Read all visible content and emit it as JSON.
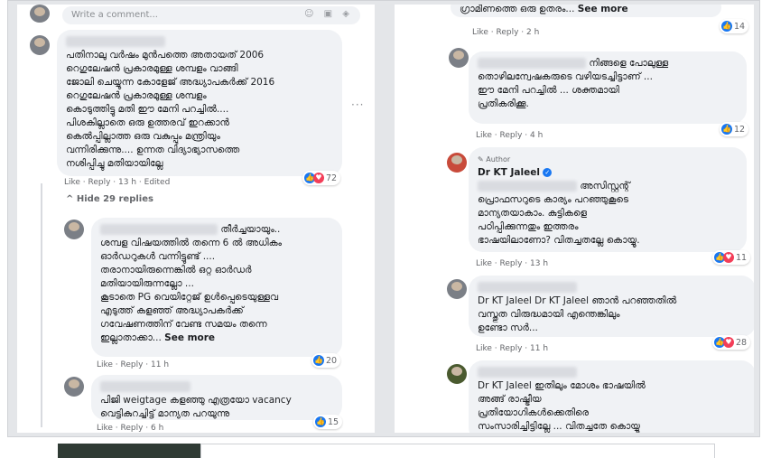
{
  "left": {
    "write_placeholder": "Write a comment...",
    "comment1": {
      "lines": [
        "പതിനാലു വർഷം മുൻപത്തെ അതായത് 2006",
        "റെഗുലേഷൻ പ്രകാരമുള്ള ശമ്പളം വാങ്ങി",
        "ജോലി ചെയ്യുന്ന കോളേജ് അദ്ധ്യാപകർക്ക് 2016",
        "റെഗുലേഷൻ പ്രകാരമുള്ള ശമ്പളം",
        "കൊടുത്തിട്ടു മതി ഈ മേനി പറച്ചിൽ....",
        "പിശകില്ലാതെ ഒരു ഉത്തരവ് ഇറക്കാൻ",
        "കെൽപ്പില്ലാത്ത ഒരു വകുപ്പും മന്ത്രിയും",
        "വന്നിരിക്കുന്നു.... ഉന്നത വിദ്യാഭ്യാസത്തെ",
        "നശിപ്പിച്ചു മതിയായില്ലേ"
      ],
      "meta": "Like · Reply · 13 h · Edited",
      "reactions": "72",
      "hide_replies": "^ Hide 29 replies"
    },
    "reply1": {
      "lines": [
        "തീർച്ചയായും..",
        "ശമ്പള വിഷയത്തിൽ തന്നെ 6 ൽ അധികം",
        "ഓർഡറുകൾ വന്നിട്ടുണ്ട് ....",
        "തരാനായിരുന്നെങ്കിൽ ഒറ്റ ഓർഡർ",
        "മതിയായിരുന്നല്ലോ ...",
        "കൂടാതെ PG വെയിറ്റേജ് ഉൾപ്പെടെയുള്ളവ",
        "എടുത്ത് കളഞ്ഞ് അദ്ധ്യാപകർക്ക്",
        "ഗവേഷണത്തിന് വേണ്ട സമയം തന്നെ",
        "ഇല്ലാതാക്കാ..."
      ],
      "see_more": "See more",
      "meta": "Like · Reply · 11 h",
      "reactions": "20"
    },
    "reply2": {
      "lines": [
        "പിജി weigtage കളഞ്ഞു എത്രയോ vacancy",
        "വെട്ടികുറച്ചിട്ട് മാന്യത പറയുന്നു"
      ],
      "meta": "Like · Reply · 6 h",
      "reactions": "15"
    }
  },
  "right": {
    "top_fragment": "ഗ്രാമീണത്തെ ഒരു ഉതരം...",
    "top_see_more": "See more",
    "top_meta": "Like · Reply · 2 h",
    "top_reactions": "14",
    "comment2": {
      "lines": [
        "നിങ്ങളെ പോലുള്ള",
        "തൊഴിലന്വേഷകരുടെ വഴിയടച്ചിട്ടാണ് ...",
        "ഈ മേനി പറച്ചിൽ ... ശക്തമായി",
        "പ്രതികരിക്കൂ."
      ],
      "meta": "Like · Reply · 4 h",
      "reactions": "12"
    },
    "comment3": {
      "author_tag": "Author",
      "name": "Dr KT Jaleel",
      "lines": [
        "അസിസ്റ്റന്റ്",
        "പ്രൊഫസറുടെ കാര്യം പറഞ്ഞുകൂടെ",
        "മാന്യതയാകാം. കുട്ടികളെ",
        "പഠിപ്പിക്കുന്നതും ഇത്തരം",
        "ഭാഷയിലാണോ? വിതച്ചതല്ലേ കൊയ്യൂ."
      ],
      "meta": "Like · Reply · 13 h",
      "reactions": "11"
    },
    "comment4": {
      "lines": [
        "Dr KT Jaleel Dr KT Jaleel ഞാൻ പറഞ്ഞതിൽ",
        "വസ്തുത വിരുദ്ധമായി എന്തെങ്കിലും",
        "ഉണ്ടോ സർ..."
      ],
      "meta": "Like · Reply · 11 h",
      "reactions": "28"
    },
    "comment5": {
      "lines": [
        "Dr KT Jaleel ഇതിലും മോശം ഭാഷയിൽ",
        "അങ്ങ് രാഷ്ട്രീയ",
        "പ്രതിയോഗികൾക്കെതിരെ",
        "സംസാരിച്ചിട്ടില്ലേ ... വിതച്ചതേ കൊയ്യൂ"
      ]
    }
  }
}
